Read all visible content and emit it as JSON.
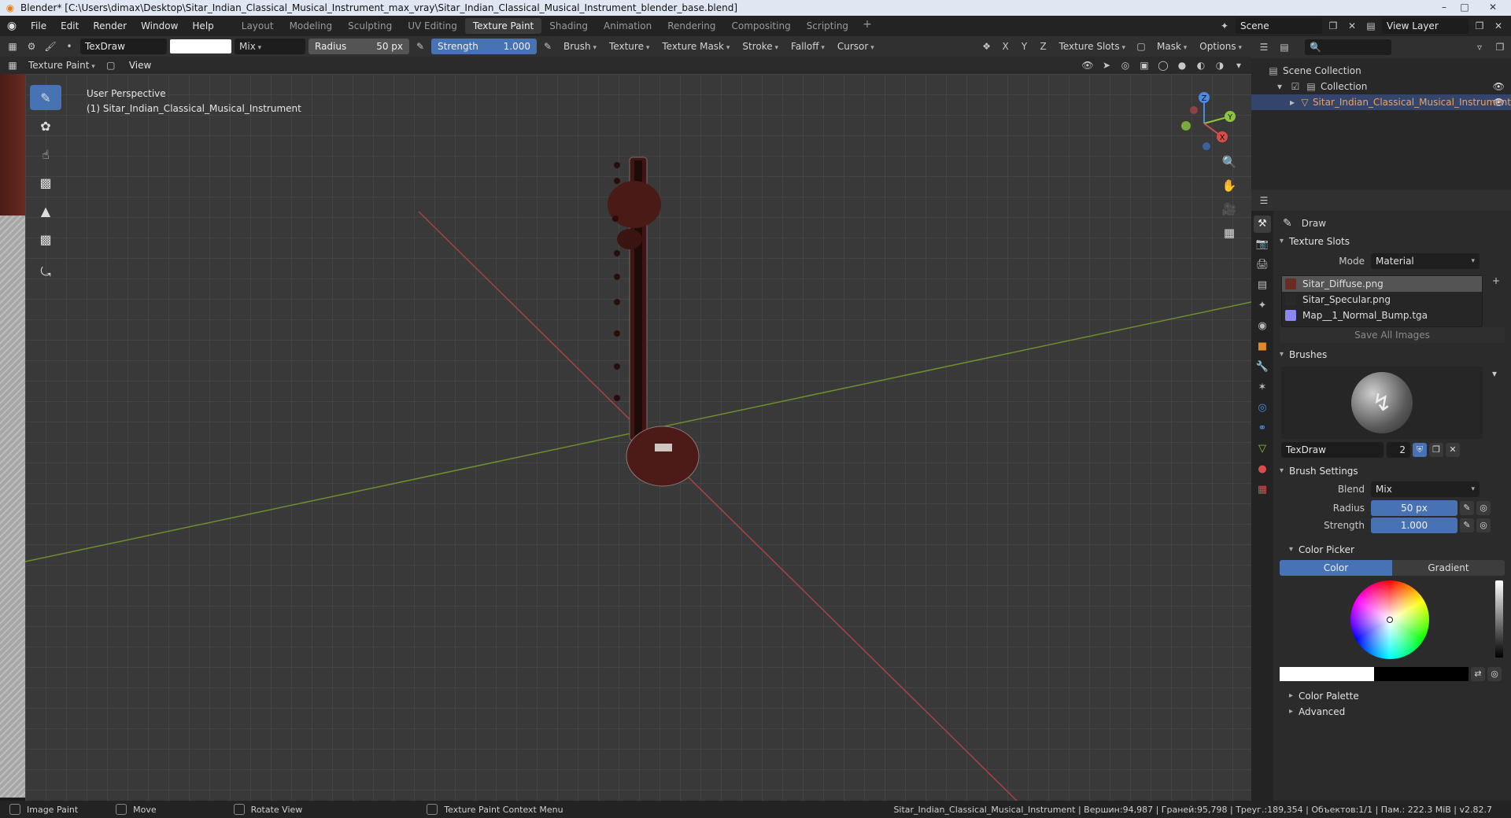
{
  "window": {
    "title": "Blender* [C:\\Users\\dimax\\Desktop\\Sitar_Indian_Classical_Musical_Instrument_max_vray\\Sitar_Indian_Classical_Musical_Instrument_blender_base.blend]"
  },
  "menu": [
    "File",
    "Edit",
    "Render",
    "Window",
    "Help"
  ],
  "workspaces": [
    {
      "label": "Layout",
      "active": false
    },
    {
      "label": "Modeling",
      "active": false
    },
    {
      "label": "Sculpting",
      "active": false
    },
    {
      "label": "UV Editing",
      "active": false
    },
    {
      "label": "Texture Paint",
      "active": true
    },
    {
      "label": "Shading",
      "active": false
    },
    {
      "label": "Animation",
      "active": false
    },
    {
      "label": "Rendering",
      "active": false
    },
    {
      "label": "Compositing",
      "active": false
    },
    {
      "label": "Scripting",
      "active": false
    }
  ],
  "scene": {
    "name": "Scene",
    "view_layer": "View Layer"
  },
  "tool_header": {
    "brush_name": "TexDraw",
    "blend": "Mix",
    "radius_label": "Radius",
    "radius_value": "50 px",
    "strength_label": "Strength",
    "strength_value": "1.000",
    "menus": [
      "Brush",
      "Texture",
      "Texture Mask",
      "Stroke",
      "Falloff",
      "Cursor"
    ],
    "axes": [
      "X",
      "Y",
      "Z"
    ],
    "right_menus": [
      "Texture Slots",
      "Mask",
      "Options"
    ]
  },
  "mode_header": {
    "mode": "Texture Paint",
    "view": "View"
  },
  "viewport": {
    "perspective": "User Perspective",
    "object_label": "(1) Sitar_Indian_Classical_Musical_Instrument",
    "gizmo": {
      "x": "X",
      "y": "Y",
      "z": "Z"
    }
  },
  "outliner": {
    "items": [
      {
        "label": "Scene Collection",
        "level": 0
      },
      {
        "label": "Collection",
        "level": 1
      },
      {
        "label": "Sitar_Indian_Classical_Musical_Instrument",
        "level": 2,
        "selected": true
      }
    ]
  },
  "properties": {
    "tool_name": "Draw",
    "texture_slots": {
      "title": "Texture Slots",
      "mode_label": "Mode",
      "mode_value": "Material",
      "slots": [
        {
          "name": "Sitar_Diffuse.png",
          "selected": true,
          "color": "#6b2a22"
        },
        {
          "name": "Sitar_Specular.png",
          "selected": false,
          "color": "#2a2a2a"
        },
        {
          "name": "Map__1_Normal_Bump.tga",
          "selected": false,
          "color": "#8a86f5"
        }
      ],
      "save_all": "Save All Images"
    },
    "brushes": {
      "title": "Brushes",
      "brush_name": "TexDraw",
      "users": "2"
    },
    "brush_settings": {
      "title": "Brush Settings",
      "blend_label": "Blend",
      "blend_value": "Mix",
      "radius_label": "Radius",
      "radius_value": "50 px",
      "strength_label": "Strength",
      "strength_value": "1.000"
    },
    "color_picker": {
      "title": "Color Picker",
      "tab_color": "Color",
      "tab_gradient": "Gradient"
    },
    "color_palette": "Color Palette",
    "advanced": "Advanced"
  },
  "status": {
    "left": [
      {
        "label": "Image Paint"
      },
      {
        "label": "Move"
      },
      {
        "label": "Rotate View"
      },
      {
        "label": "Texture Paint Context Menu"
      }
    ],
    "right": "Sitar_Indian_Classical_Musical_Instrument | Вершин:94,987 | Граней:95,798 | Треуг.:189,354 | Объектов:1/1 | Пам.: 222.3 MiB | v2.82.7"
  },
  "colors": {
    "accent": "#4772b3",
    "selected_text": "#f0a05a",
    "x_axis": "#d94c4c",
    "y_axis": "#8cc63f",
    "z_axis": "#4c8be0"
  }
}
